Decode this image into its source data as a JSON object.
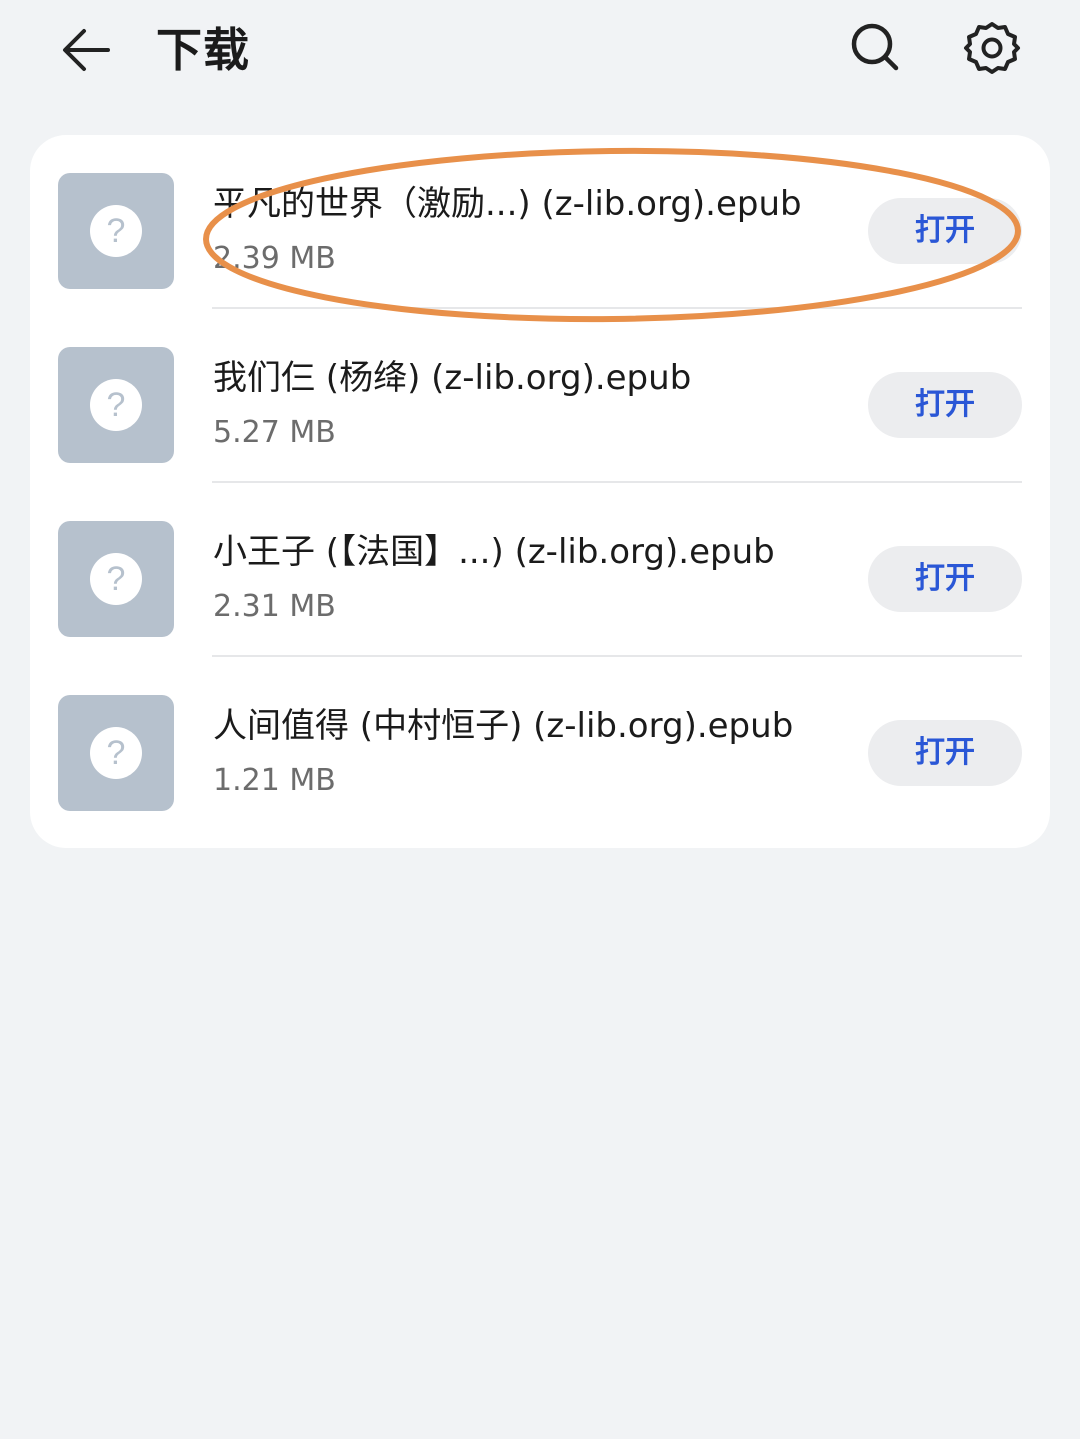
{
  "header": {
    "title": "下载",
    "back_icon": "arrow-left-icon",
    "search_icon": "search-icon",
    "settings_icon": "gear-icon"
  },
  "downloads": [
    {
      "name": "平凡的世界（激励...) (z-lib.org).epub",
      "size": "2.39 MB",
      "action": "打开",
      "icon": "unknown-file-icon"
    },
    {
      "name": "我们仨 (杨绛) (z-lib.org).epub",
      "size": "5.27 MB",
      "action": "打开",
      "icon": "unknown-file-icon"
    },
    {
      "name": "小王子 (【法国】...) (z-lib.org).epub",
      "size": "2.31 MB",
      "action": "打开",
      "icon": "unknown-file-icon"
    },
    {
      "name": "人间值得 (中村恒子) (z-lib.org).epub",
      "size": "1.21 MB",
      "action": "打开",
      "icon": "unknown-file-icon"
    }
  ],
  "colors": {
    "background": "#f1f3f5",
    "accent": "#2a57d6",
    "annotation": "#e8904a",
    "thumbnail": "#b6c1cd"
  }
}
